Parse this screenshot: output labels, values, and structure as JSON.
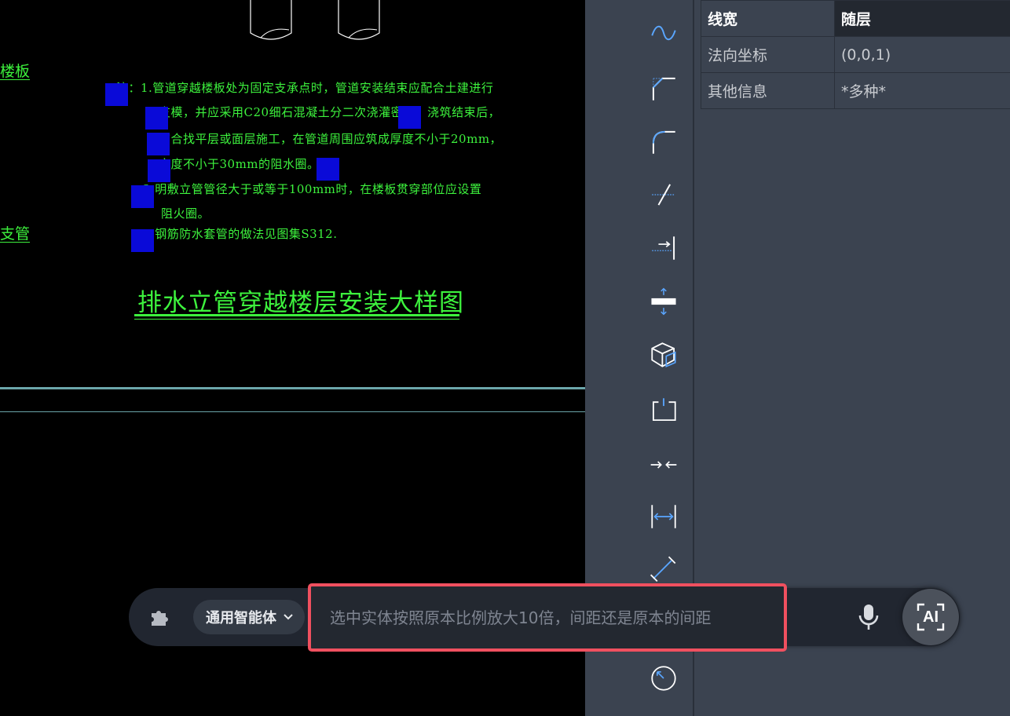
{
  "canvas": {
    "left_labels": [
      "楼板",
      "支管"
    ],
    "notes": {
      "line1": "注：1.管道穿越楼板处为固定支承点时，管道安装结束应配合土建进行",
      "line2": "支模，并应采用C20细石混凝土分二次浇灌密实。浇筑结束后，",
      "line3": "结合找平层或面层施工，在管道周围应筑成厚度不小于20mm，",
      "line4": "宽度不小于30mm的阻水圈。",
      "line5": "2.明敷立管管径大于或等于100mm时，在楼板贯穿部位应设置",
      "line6": "阻火圈。",
      "line7": "3.钢筋防水套管的做法见图集S312."
    },
    "title": "排水立管穿越楼层安装大样图"
  },
  "toolbar": {
    "tools": [
      "spline-icon",
      "chamfer-icon",
      "fillet-icon",
      "break-icon",
      "extend-icon",
      "offset-icon",
      "3d-box-icon",
      "stretch-icon",
      "join-icon",
      "dimension-linear-icon",
      "dimension-aligned-icon",
      "dimension-radius-icon"
    ]
  },
  "properties": {
    "rows": [
      {
        "key": "线宽",
        "value": "随层"
      },
      {
        "key": "法向坐标",
        "value": "(0,0,1)"
      },
      {
        "key": "其他信息",
        "value": "*多种*"
      }
    ]
  },
  "aibar": {
    "agent_label": "通用智能体",
    "prompt_value": "选中实体按照原本比例放大10倍，间距还是原本的间距",
    "ai_label": "AI"
  },
  "colors": {
    "cad_green": "#3df23d",
    "grip_blue": "#0a0ad8",
    "panel_bg": "#3b4350",
    "highlight_red": "#f0505f"
  }
}
